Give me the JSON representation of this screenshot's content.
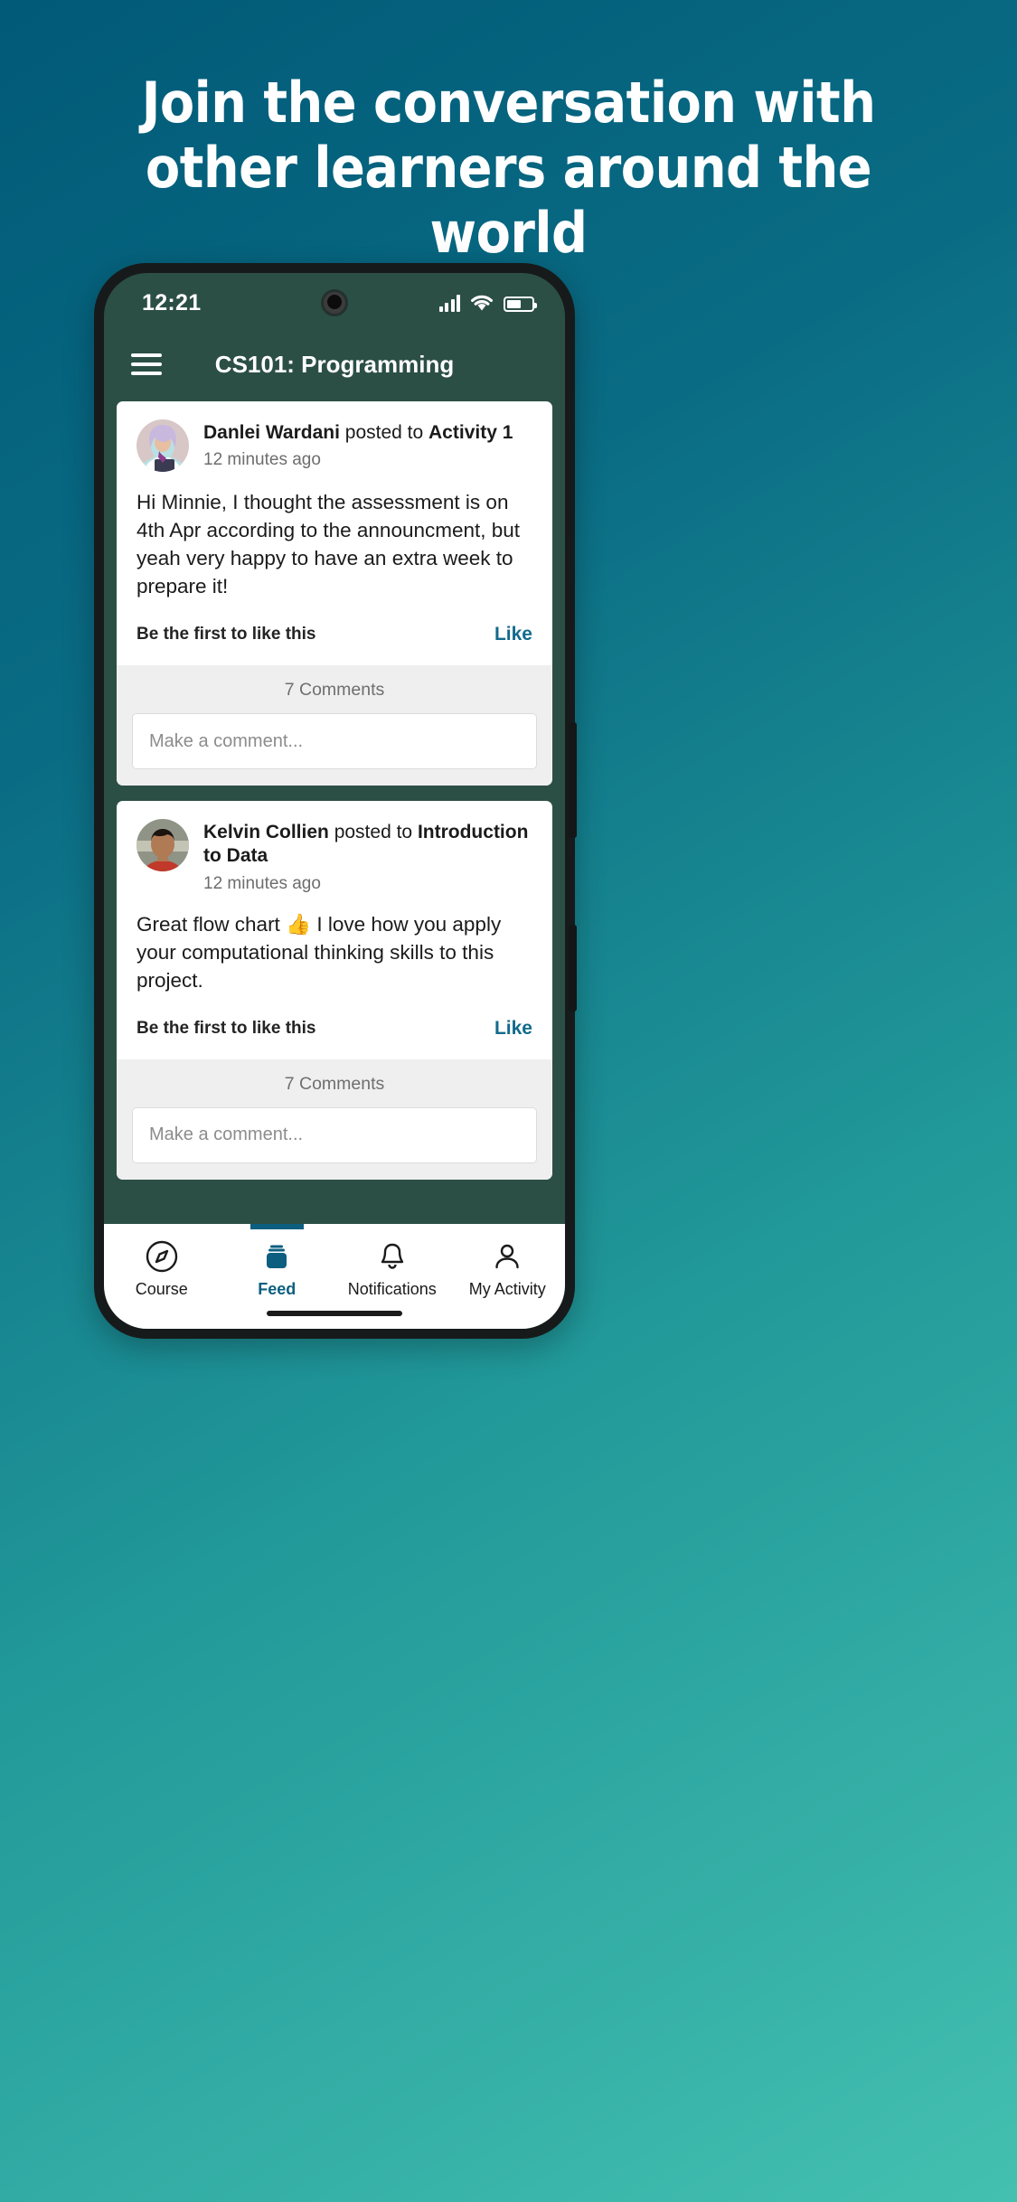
{
  "promo": {
    "headline": "Join the conversation with other learners around the world",
    "text_color": "#ffffff",
    "background_gradient": [
      "#015a78",
      "#229a9a",
      "#44c0b0"
    ]
  },
  "phone": {
    "status_bar": {
      "time": "12:21",
      "signal_icon": "cellular-signal-icon",
      "wifi_icon": "wifi-icon",
      "battery_icon": "battery-icon",
      "battery_level": "58%"
    },
    "app_bar": {
      "menu_icon": "hamburger-menu-icon",
      "title": "CS101: Programming",
      "background": "#2c4f45"
    }
  },
  "feed": {
    "posts": [
      {
        "author": "Danlei Wardani",
        "action": "posted to",
        "target": "Activity 1",
        "timestamp": "12 minutes ago",
        "body": "Hi Minnie, I thought the assessment is on 4th Apr according to the announcment, but yeah very happy to have an extra week to prepare it!",
        "like_status": "Be the first to like this",
        "like_action": "Like",
        "comments_count": "7 Comments",
        "comment_placeholder": "Make a comment...",
        "avatar": "avatar-woman-hijab"
      },
      {
        "author": "Kelvin Collien",
        "action": "posted to",
        "target": "Introduction to Data",
        "timestamp": "12 minutes ago",
        "body": "Great flow chart 👍 I love how you apply your computational thinking skills to this project.",
        "like_status": "Be the first to like this",
        "like_action": "Like",
        "comments_count": "7 Comments",
        "comment_placeholder": "Make a comment...",
        "avatar": "avatar-man"
      }
    ],
    "link_color": "#126a8c"
  },
  "bottom_nav": {
    "active_index": 1,
    "active_color": "#0d5f80",
    "items": [
      {
        "label": "Course",
        "icon": "compass-icon"
      },
      {
        "label": "Feed",
        "icon": "feed-stack-icon"
      },
      {
        "label": "Notifications",
        "icon": "bell-icon"
      },
      {
        "label": "My Activity",
        "icon": "person-icon"
      }
    ]
  }
}
